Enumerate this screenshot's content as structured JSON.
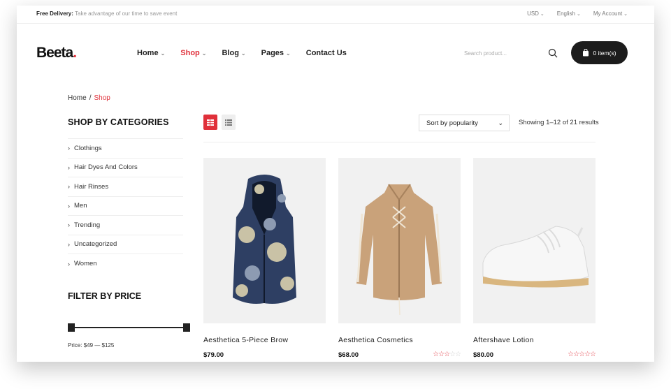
{
  "topbar": {
    "promo_bold": "Free Delivery:",
    "promo_text": "Take advantage of our time to save event",
    "currency": "USD",
    "language": "English",
    "account": "My Account"
  },
  "header": {
    "logo_text": "Beeta",
    "logo_dot": ".",
    "nav": [
      {
        "label": "Home",
        "has_dropdown": true
      },
      {
        "label": "Shop",
        "has_dropdown": true
      },
      {
        "label": "Blog",
        "has_dropdown": true
      },
      {
        "label": "Pages",
        "has_dropdown": true
      },
      {
        "label": "Contact Us",
        "has_dropdown": false
      }
    ],
    "active_nav": "Shop",
    "search_placeholder": "Search product...",
    "cart_label": "0 item(s)"
  },
  "breadcrumb": {
    "home": "Home",
    "separator": "/",
    "current": "Shop"
  },
  "sidebar": {
    "categories_title": "SHOP BY CATEGORIES",
    "categories": [
      "Clothings",
      "Hair Dyes And Colors",
      "Hair Rinses",
      "Men",
      "Trending",
      "Uncategorized",
      "Women"
    ],
    "price_title": "FILTER BY PRICE",
    "price_label": "Price:",
    "price_min": "$49",
    "price_dash": "—",
    "price_max": "$125"
  },
  "toolbar": {
    "sort_value": "Sort by popularity",
    "result_count": "Showing 1–12 of 21 results"
  },
  "products": [
    {
      "name": "Aesthetica 5-Piece Brow",
      "price": "$79.00",
      "rating_stars": 0,
      "image": "camo-vest"
    },
    {
      "name": "Aesthetica Cosmetics",
      "price": "$68.00",
      "rating_stars": 3,
      "image": "beige-jacket"
    },
    {
      "name": "Aftershave Lotion",
      "price": "$80.00",
      "rating_stars": 5,
      "image": "white-sneaker"
    }
  ],
  "colors": {
    "accent": "#e0303a",
    "dark": "#1c1c1c",
    "product_bg": "#f1f1f1"
  }
}
